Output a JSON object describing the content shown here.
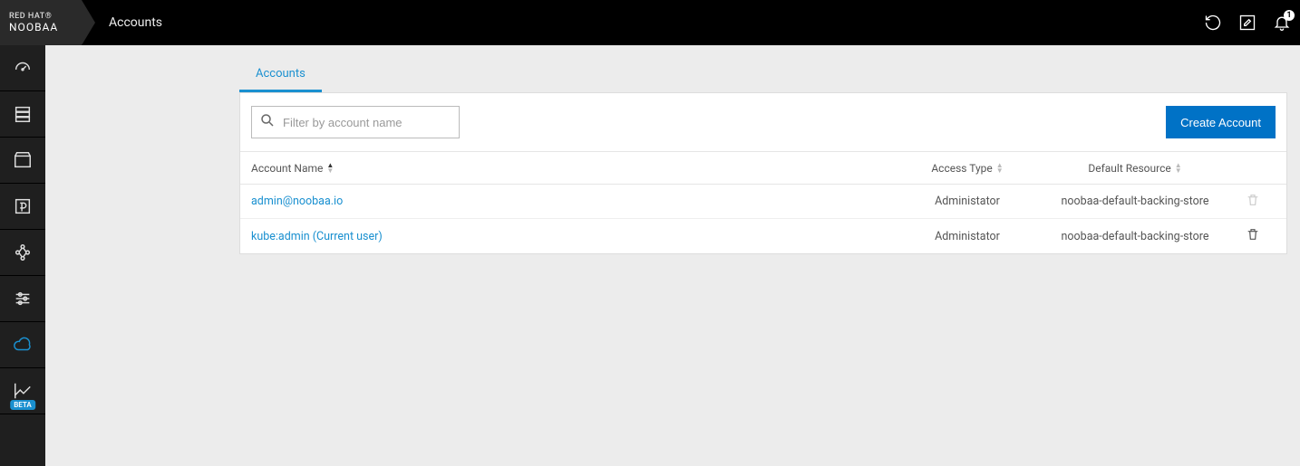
{
  "brand": {
    "line1": "RED HAT®",
    "line2": "NOOBAA"
  },
  "header": {
    "title": "Accounts",
    "notification_count": "1"
  },
  "sidebar": {
    "items": [
      {
        "name": "dashboard",
        "active": false
      },
      {
        "name": "resources",
        "active": false
      },
      {
        "name": "buckets",
        "active": false
      },
      {
        "name": "functions",
        "active": false
      },
      {
        "name": "pool",
        "active": false
      },
      {
        "name": "settings",
        "active": false
      },
      {
        "name": "cloud",
        "active": true
      },
      {
        "name": "analytics",
        "active": false,
        "beta": true
      }
    ],
    "beta_label": "BETA"
  },
  "tabs": [
    {
      "label": "Accounts",
      "active": true
    }
  ],
  "toolbar": {
    "search_placeholder": "Filter by account name",
    "create_label": "Create Account"
  },
  "table": {
    "columns": {
      "name": "Account Name",
      "access": "Access Type",
      "resource": "Default Resource"
    },
    "rows": [
      {
        "name": "admin@noobaa.io",
        "access": "Administator",
        "resource": "noobaa-default-backing-store",
        "deletable": false
      },
      {
        "name": "kube:admin (Current user)",
        "access": "Administator",
        "resource": "noobaa-default-backing-store",
        "deletable": true
      }
    ]
  }
}
